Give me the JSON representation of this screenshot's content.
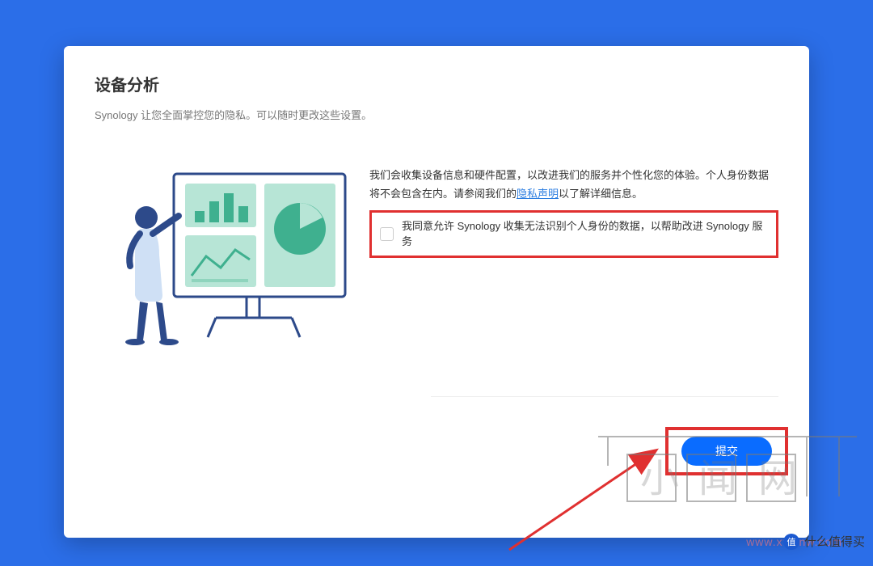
{
  "title": "设备分析",
  "subtitle": "Synology 让您全面掌控您的隐私。可以随时更改这些设置。",
  "desc_a": "我们会收集设备信息和硬件配置，以改进我们的服务并个性化您的体验。个人身份数据将不会包含在内。请参阅我们的",
  "privacy_link": "隐私声明",
  "desc_b": "以了解详细信息。",
  "consent": "我同意允许 Synology 收集无法识别个人身份的数据，以帮助改进 Synology 服务",
  "submit": "提交",
  "watermark_url": "www.xwenw.com",
  "smzdm_label": "什么值得买",
  "smzdm_badge": "值"
}
